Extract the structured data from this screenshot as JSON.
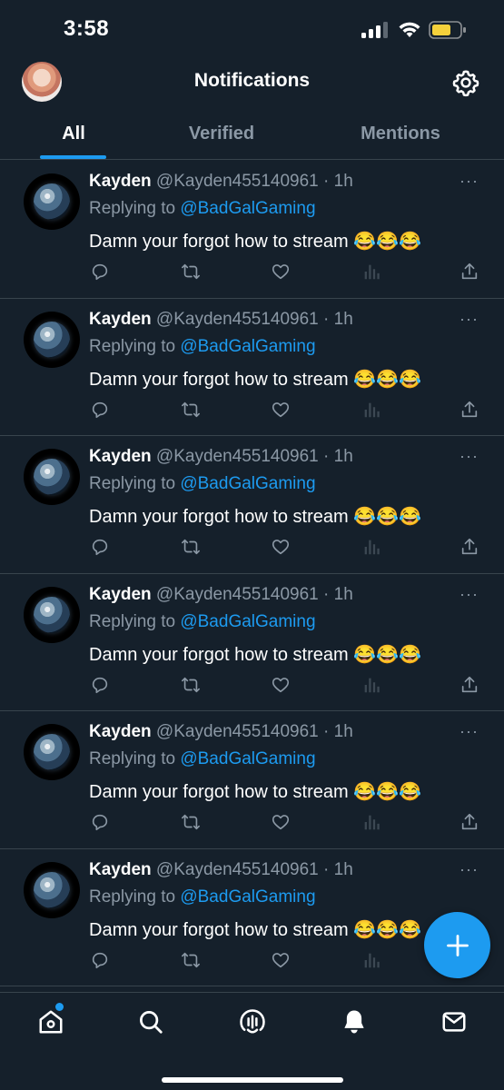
{
  "status_bar": {
    "time": "3:58",
    "battery_color": "#f5d13b"
  },
  "header": {
    "title": "Notifications",
    "avatar_icon": "profile-avatar",
    "settings_icon": "gear-icon"
  },
  "tabs": [
    {
      "label": "All",
      "active": true
    },
    {
      "label": "Verified",
      "active": false
    },
    {
      "label": "Mentions",
      "active": false
    }
  ],
  "tweet": {
    "name": "Kayden",
    "handle": "@Kayden455140961",
    "dot": "·",
    "time": "1h",
    "more": "···",
    "replying_prefix": "Replying to",
    "replying_to": "@BadGalGaming",
    "text": "Damn your forgot how to stream 😂😂😂"
  },
  "tweet_count": 6,
  "colors": {
    "background": "#15202b",
    "accent": "#1d9bf0",
    "muted": "#8b98a5",
    "divider": "#38444d"
  },
  "bottom_nav": [
    "home-icon",
    "search-icon",
    "spaces-icon",
    "notifications-icon",
    "messages-icon"
  ]
}
